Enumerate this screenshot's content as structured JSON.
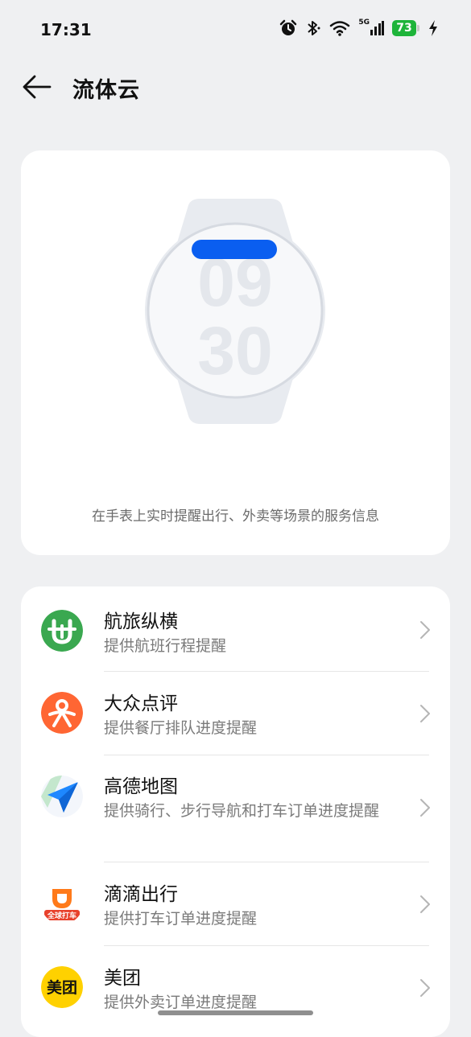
{
  "status_bar": {
    "time": "17:31",
    "network": "5G",
    "battery": "73",
    "icons": [
      "alarm-icon",
      "bluetooth-icon",
      "wifi-icon",
      "signal-icon",
      "battery-icon",
      "charging-icon"
    ]
  },
  "header": {
    "title": "流体云",
    "back_icon": "arrow-left-icon"
  },
  "hero": {
    "watch_hour": "09",
    "watch_minute": "30",
    "description": "在手表上实时提醒出行、外卖等场景的服务信息"
  },
  "apps": [
    {
      "name": "航旅纵横",
      "description": "提供航班行程提醒",
      "icon": "hanglv-app-icon",
      "icon_color": "#3aa850"
    },
    {
      "name": "大众点评",
      "description": "提供餐厅排队进度提醒",
      "icon": "dianping-app-icon",
      "icon_color": "#ff6633"
    },
    {
      "name": "高德地图",
      "description": "提供骑行、步行导航和打车订单进度提醒",
      "icon": "amap-app-icon",
      "icon_color": "#1e88ff"
    },
    {
      "name": "滴滴出行",
      "description": "提供打车订单进度提醒",
      "icon": "didi-app-icon",
      "icon_color": "#ff7a1a",
      "icon_text": "全球打车"
    },
    {
      "name": "美团",
      "description": "提供外卖订单进度提醒",
      "icon": "meituan-app-icon",
      "icon_color": "#ffd100",
      "icon_text": "美团"
    }
  ],
  "colors": {
    "background": "#eff0f2",
    "card": "#ffffff",
    "accent_blue": "#0a5ef0",
    "battery_green": "#1eb43a"
  }
}
